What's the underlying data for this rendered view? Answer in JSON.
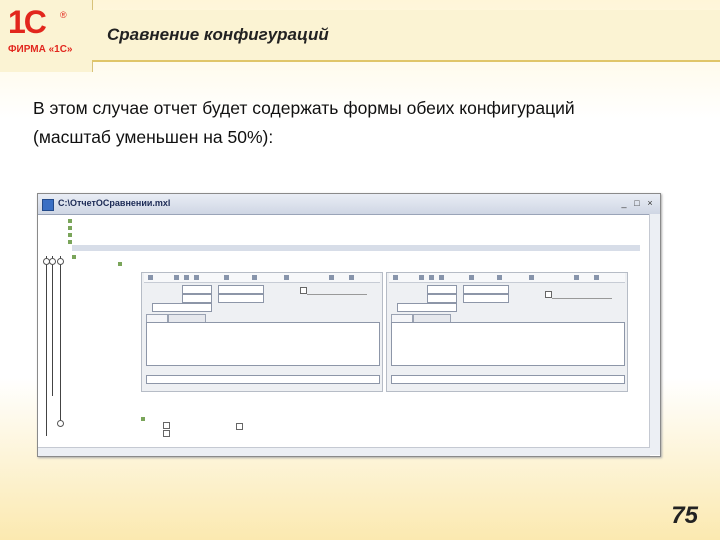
{
  "logo": {
    "mark": "1С",
    "reg": "®",
    "text": "ФИРМА «1С»"
  },
  "slide": {
    "title": "Сравнение конфигураций",
    "body_line1": "В этом случае отчет будет содержать формы обеих конфигураций",
    "body_line2": "(масштаб уменьшен на 50%):",
    "page_number": "75"
  },
  "screenshot": {
    "window_title": "C:\\ОтчетОСравнении.mxl",
    "window_buttons": {
      "minimize": "_",
      "restore": "□",
      "close": "×"
    }
  },
  "colors": {
    "brand_red": "#e2261d",
    "title_band": "#fbf3d3"
  }
}
